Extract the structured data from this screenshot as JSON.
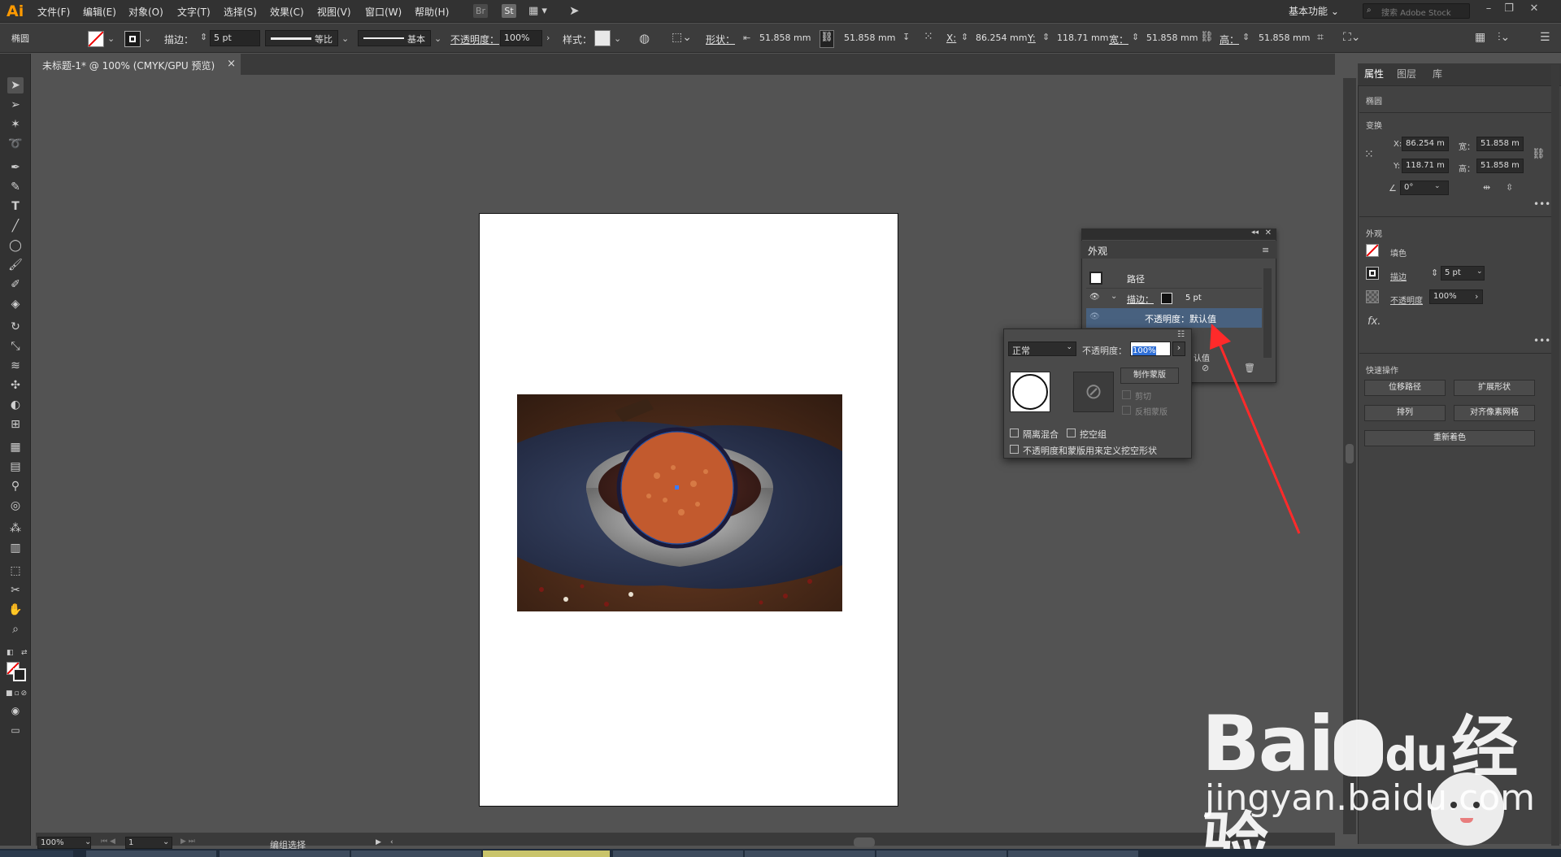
{
  "app": {
    "logo": "Ai",
    "workspace": "基本功能",
    "search_placeholder": "搜索 Adobe Stock"
  },
  "menus": [
    "文件(F)",
    "编辑(E)",
    "对象(O)",
    "文字(T)",
    "选择(S)",
    "效果(C)",
    "视图(V)",
    "窗口(W)",
    "帮助(H)"
  ],
  "menu_icons": [
    "Br",
    "St"
  ],
  "control_bar": {
    "object_type": "椭圆",
    "stroke_label": "描边：",
    "stroke_value": "5 pt",
    "stroke_profile": "等比",
    "brush": "基本",
    "opacity_label": "不透明度：",
    "opacity_value": "100%",
    "style_label": "样式：",
    "shape_label": "形状：",
    "shape_w": "51.858 mm",
    "shape_h": "51.858 mm",
    "x_label": "X:",
    "x_value": "86.254 mm",
    "y_label": "Y:",
    "y_value": "118.71 mm",
    "w_label": "宽：",
    "w_value": "51.858 mm",
    "h_label": "高：",
    "h_value": "51.858 mm"
  },
  "document": {
    "tab_title": "未标题-1* @ 100% (CMYK/GPU 预览)",
    "zoom": "100%",
    "artboard": "1",
    "status": "编组选择"
  },
  "properties": {
    "tabs": [
      "属性",
      "图层",
      "库"
    ],
    "object": "椭圆",
    "transform_title": "变换",
    "x_label": "X:",
    "x_value": "86.254 m",
    "y_label": "Y:",
    "y_value": "118.71 m",
    "w_label": "宽：",
    "w_value": "51.858 m",
    "h_label": "高：",
    "h_value": "51.858 m",
    "angle": "0°",
    "appearance_title": "外观",
    "fill_label": "填色",
    "stroke_label": "描边",
    "stroke_value": "5 pt",
    "opacity_label": "不透明度",
    "opacity_value": "100%",
    "fx": "fx.",
    "quick_title": "快速操作",
    "buttons": [
      "位移路径",
      "扩展形状",
      "排列",
      "对齐像素网格",
      "重新着色"
    ]
  },
  "appearance_panel": {
    "title": "外观",
    "path_label": "路径",
    "stroke_label": "描边：",
    "stroke_value": "5 pt",
    "opacity_row": "不透明度：默认值",
    "partial_text": "认值"
  },
  "transparency": {
    "blend_mode": "正常",
    "opacity_label": "不透明度：",
    "opacity_value": "100%",
    "make_mask": "制作蒙版",
    "clip": "剪切",
    "invert": "反相蒙版",
    "isolate": "隔离混合",
    "knockout": "挖空组",
    "define_knockout": "不透明度和蒙版用来定义挖空形状"
  },
  "watermark": {
    "brand": "Bai",
    "brand2": "du",
    "brand3": "经验",
    "url": "jingyan.baidu.com"
  },
  "colors": {
    "accent": "#ff9a00",
    "arrow": "#ff2a2a",
    "selection": "#1b4fa8"
  }
}
